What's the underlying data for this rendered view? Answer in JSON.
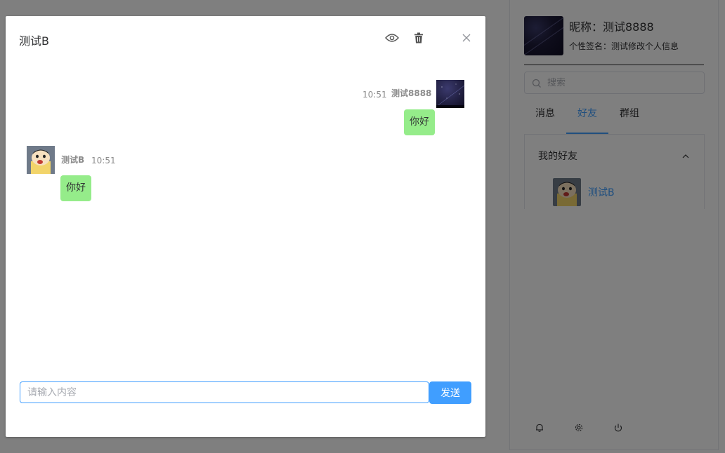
{
  "profile": {
    "nickname": "昵称：测试8888",
    "signature": "个性签名：测试修改个人信息"
  },
  "search": {
    "placeholder": "搜索",
    "icon": "search-icon"
  },
  "tabs": [
    {
      "label": "消息",
      "active": false
    },
    {
      "label": "好友",
      "active": true
    },
    {
      "label": "群组",
      "active": false
    }
  ],
  "friends": {
    "group_title": "我的好友",
    "items": [
      {
        "name": "测试B"
      }
    ]
  },
  "bottom_icons": [
    "bell-icon",
    "gear-icon",
    "power-icon"
  ],
  "chat": {
    "title": "测试B",
    "header_icons": [
      "eye-icon",
      "trash-icon",
      "close-icon"
    ],
    "messages": [
      {
        "sender": "测试8888",
        "time": "10:51",
        "text": "你好",
        "side": "right"
      },
      {
        "sender": "测试B",
        "time": "10:51",
        "text": "你好",
        "side": "left"
      }
    ],
    "input_placeholder": "请输入内容",
    "send_label": "发送"
  },
  "colors": {
    "accent": "#409eff",
    "bubble": "#95ec8a",
    "overlay": "rgba(0,0,0,0.5)"
  }
}
